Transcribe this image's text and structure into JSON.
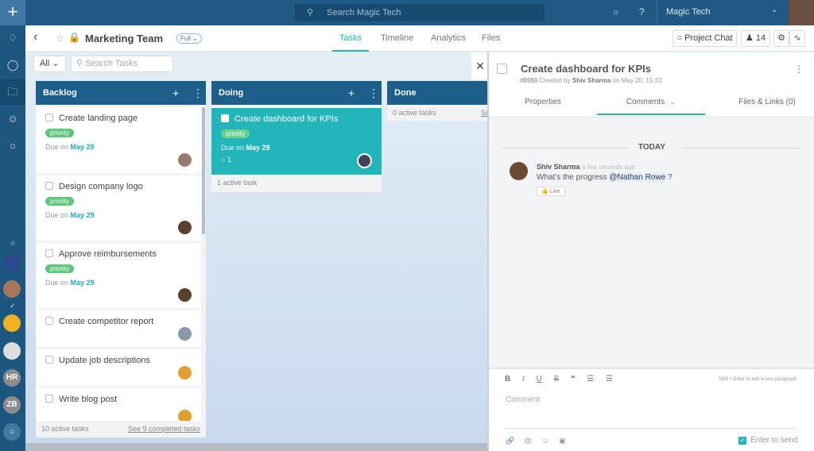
{
  "topbar": {
    "search_placeholder": "Search Magic Tech",
    "workspace": "Magic Tech"
  },
  "sidebar": {
    "initials": [
      "HR",
      "ZB"
    ]
  },
  "header": {
    "title": "Marketing Team",
    "view": "Full",
    "tabs": [
      "Tasks",
      "Timeline",
      "Analytics",
      "Files"
    ],
    "active_tab": "Tasks",
    "project_chat": "Project Chat",
    "members": "14"
  },
  "filter": {
    "value": "All",
    "search_placeholder": "Search Tasks"
  },
  "columns": [
    {
      "name": "Backlog",
      "footer": "10 active tasks",
      "completed_link": "See 9 completed tasks",
      "cards": [
        {
          "title": "Create landing page",
          "tag": "priority",
          "due_label": "Due on",
          "due": "May 29"
        },
        {
          "title": "Design company logo",
          "tag": "priority",
          "due_label": "Due on",
          "due": "May 29"
        },
        {
          "title": "Approve reimbursements",
          "tag": "priority",
          "due_label": "Due on",
          "due": "May 29"
        },
        {
          "title": "Create competitor report"
        },
        {
          "title": "Update job descriptions"
        },
        {
          "title": "Write blog post"
        }
      ]
    },
    {
      "name": "Doing",
      "footer": "1 active task",
      "cards": [
        {
          "title": "Create dashboard for KPIs",
          "tag": "priority",
          "due_label": "Due on",
          "due": "May 29",
          "comments": "1"
        }
      ]
    },
    {
      "name": "Done",
      "footer": "0 active tasks",
      "completed_link": "Se"
    }
  ],
  "panel": {
    "title": "Create dashboard for KPIs",
    "id": "#6550",
    "created_by_label": "Created by",
    "author": "Shiv Sharma",
    "date_label": "on May 20, 15:33",
    "tabs": [
      "Properties",
      "Comments",
      "Files & Links (0)"
    ],
    "active_tab": "Comments",
    "day": "TODAY",
    "comment": {
      "author": "Shiv Sharma",
      "time": "a few seconds ago",
      "text": "What's the progress",
      "mention": "@Nathan Rowe",
      "suffix": "?",
      "like": "Like"
    },
    "editor": {
      "hint": "Shift + Enter to add a new paragraph",
      "placeholder": "Comment",
      "enter_to_send": "Enter to send",
      "enter_to_send_checked": true
    }
  },
  "colors": {
    "accent": "#23b5b8",
    "navy": "#1e5e8b",
    "priority": "#5cc67b"
  }
}
